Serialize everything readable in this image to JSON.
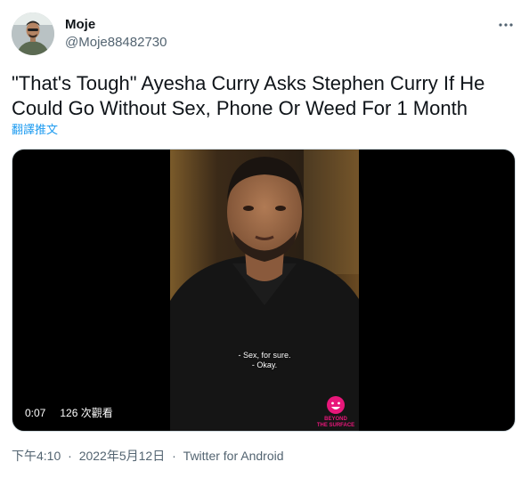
{
  "user": {
    "display_name": "Moje",
    "handle": "@Moje88482730"
  },
  "tweet": {
    "text": "\"That's Tough\" Ayesha Curry Asks Stephen Curry If He Could Go Without Sex, Phone Or Weed For 1 Month",
    "translate_label": "翻譯推文"
  },
  "video": {
    "caption": "- Sex, for sure.\n- Okay.",
    "current_time": "0:07",
    "views": "126 次觀看",
    "watermark_line1": "BEYOND",
    "watermark_line2": "THE SURFACE"
  },
  "meta": {
    "time": "下午4:10",
    "date": "2022年5月12日",
    "separator": "·",
    "source": "Twitter for Android"
  },
  "colors": {
    "link": "#1d9bf0",
    "secondary_text": "#536471",
    "watermark": "#e8177a"
  },
  "icons": {
    "more": "more-icon",
    "avatar": "avatar"
  }
}
